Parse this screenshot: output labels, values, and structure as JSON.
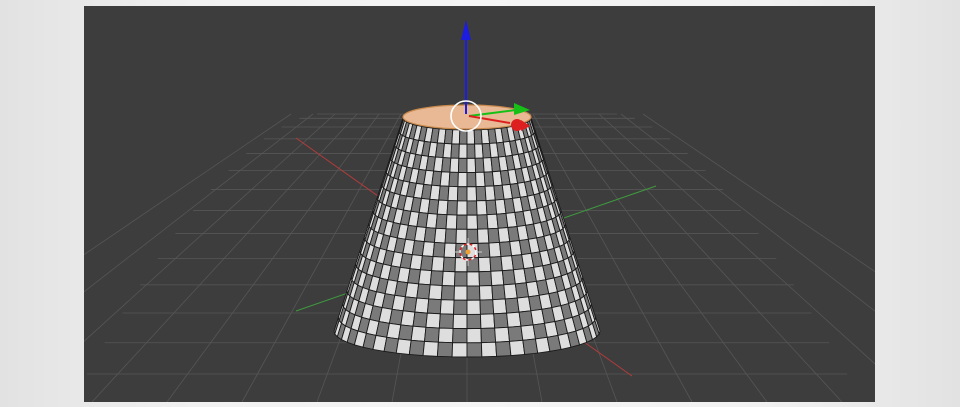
{
  "viewport": {
    "background": "#3d3d3d",
    "grid_color": "#565656",
    "x_axis_color": "#b33b3b",
    "y_axis_color": "#3f9a3f"
  },
  "object": {
    "type": "cone",
    "rows": 16,
    "top_face_color": "#e8b994",
    "face_light": "#dedede",
    "face_dark": "#7a7a7a",
    "edge_color": "#1a1a1a"
  },
  "gizmo": {
    "z_color": "#1d1de0",
    "y_color": "#17c017",
    "x_color": "#dd1f1f",
    "center_ring_color": "#ffffff"
  },
  "cursor_3d": {
    "icon": "3d-cursor-icon"
  }
}
